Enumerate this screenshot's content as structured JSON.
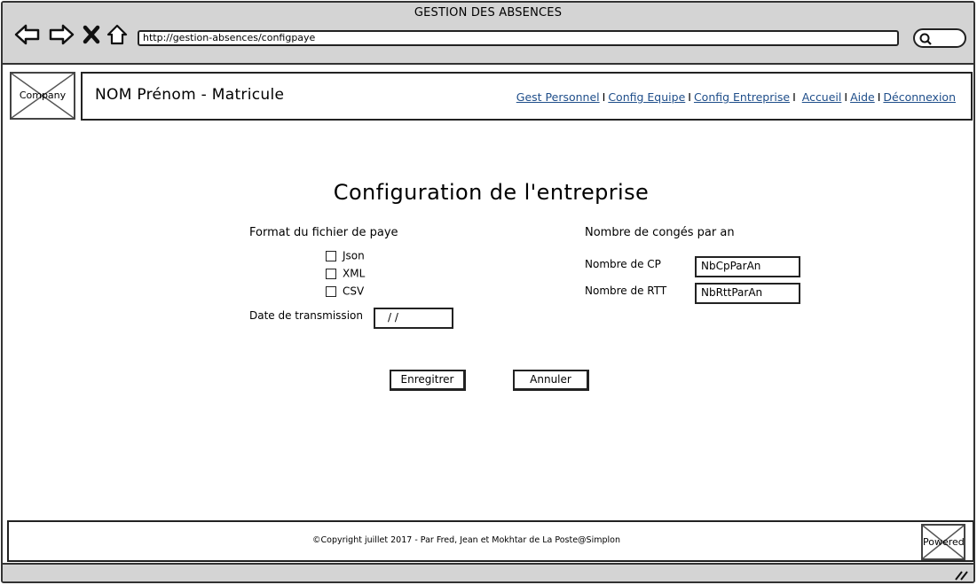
{
  "window": {
    "title": "GESTION DES ABSENCES",
    "url": "http://gestion-absences/configpaye"
  },
  "header": {
    "company_logo_label": "Company",
    "user": "NOM Prénom - Matricule",
    "nav": [
      {
        "label": "Gest Personnel"
      },
      {
        "label": "Config Equipe"
      },
      {
        "label": "Config Entreprise"
      },
      {
        "label": "Accueil"
      },
      {
        "label": "Aide"
      },
      {
        "label": "Déconnexion"
      }
    ],
    "separator": "I"
  },
  "main": {
    "title": "Configuration de l'entreprise",
    "payroll": {
      "heading": "Format du fichier de paye",
      "formats": [
        {
          "label": "Json",
          "checked": false
        },
        {
          "label": "XML",
          "checked": false
        },
        {
          "label": "CSV",
          "checked": false
        }
      ],
      "date_label": "Date de transmission",
      "date_value": "/ /"
    },
    "leave": {
      "heading": "Nombre de congés par an",
      "cp_label": "Nombre de CP",
      "cp_value": "NbCpParAn",
      "rtt_label": "Nombre de RTT",
      "rtt_value": "NbRttParAn"
    },
    "save_label": "Enregitrer",
    "cancel_label": "Annuler"
  },
  "footer": {
    "copyright": "©Copyright juillet 2017 - Par Fred, Jean et Mokhtar de La Poste@Simplon",
    "powered_label": "Powered"
  }
}
